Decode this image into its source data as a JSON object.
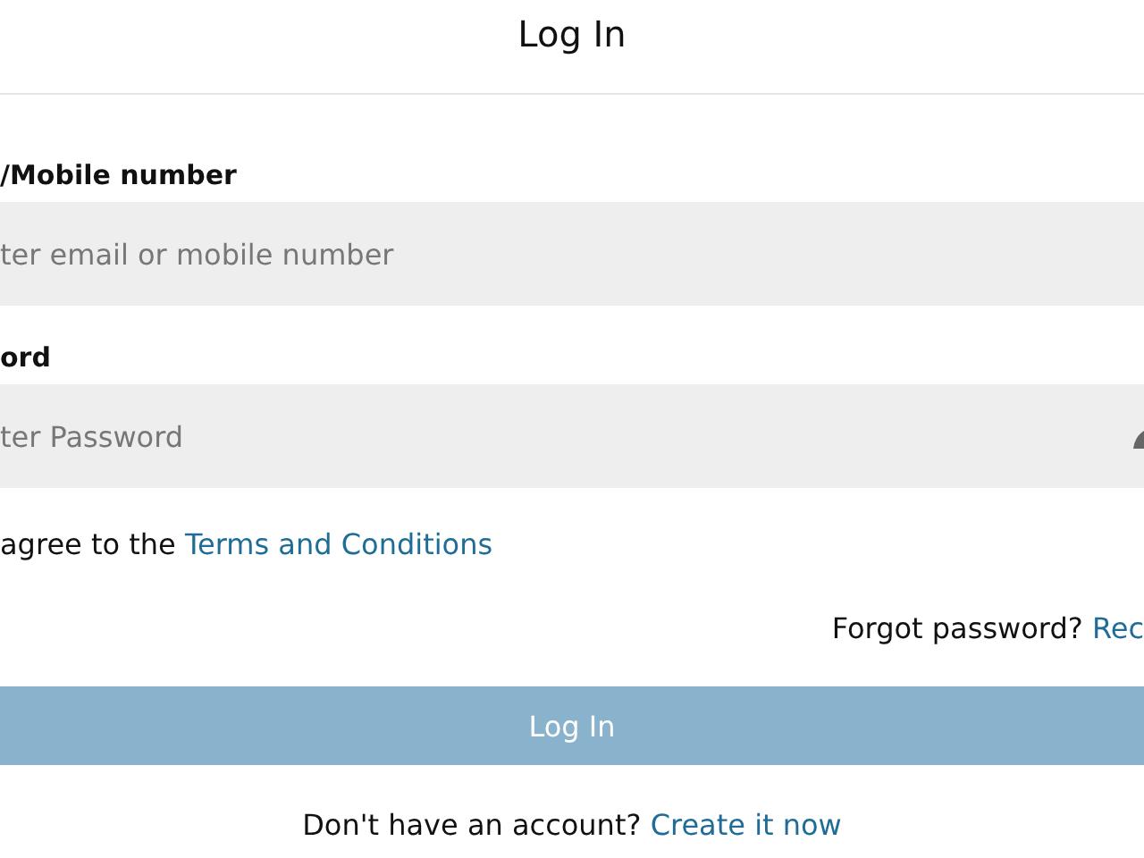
{
  "header": {
    "title": "Log In"
  },
  "fields": [
    {
      "label": "/Mobile number",
      "placeholder": "ter email or mobile number",
      "kind": "text"
    },
    {
      "label": "ord",
      "placeholder": "ter Password",
      "kind": "password"
    }
  ],
  "terms": {
    "text": "agree to the",
    "link": "Terms and Conditions"
  },
  "forgot": {
    "text": "Forgot password?",
    "link": "Rec"
  },
  "submit": {
    "label": "Log In",
    "disabled": true
  },
  "signup": {
    "text": "Don't have an account?",
    "link": "Create it now"
  }
}
